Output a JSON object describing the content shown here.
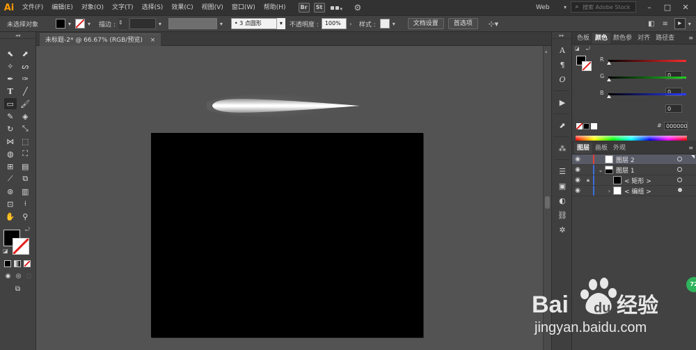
{
  "app": {
    "logo": "Ai",
    "menu": [
      "文件(F)",
      "编辑(E)",
      "对象(O)",
      "文字(T)",
      "选择(S)",
      "效果(C)",
      "视图(V)",
      "窗口(W)",
      "帮助(H)"
    ],
    "bridge_label": "Br",
    "stock_label": "St",
    "workspace": "Web",
    "search_placeholder": "搜索 Adobe Stock"
  },
  "controlbar": {
    "selection_label": "未选择对象",
    "stroke_label": "描边 :",
    "brush_value": "3 点圆形",
    "opacity_label": "不透明度 :",
    "opacity_value": "100%",
    "style_label": "样式 :",
    "doc_setup_button": "文档设置",
    "preferences_button": "首选项"
  },
  "document": {
    "tab_title": "未标题-2* @ 66.67% (RGB/预览)",
    "close": "×"
  },
  "color_panel": {
    "tabs": [
      "色板",
      "颜色",
      "颜色参",
      "对齐",
      "路径查"
    ],
    "active_tab": "颜色",
    "channels": [
      {
        "label": "R",
        "value": "0",
        "color": "#ff2a2a"
      },
      {
        "label": "G",
        "value": "0",
        "color": "#21d021"
      },
      {
        "label": "B",
        "value": "0",
        "color": "#2a3cff"
      }
    ],
    "hex_symbol": "#",
    "hex_value": "000000"
  },
  "layers_panel": {
    "tabs": [
      "图层",
      "画板",
      "外观"
    ],
    "active_tab": "图层",
    "rows": [
      {
        "name": "图层 2",
        "color": "#e0403a",
        "selected": true,
        "thumb": "white",
        "indent": 0,
        "arrow": ""
      },
      {
        "name": "图层 1",
        "color": "#3a6ee0",
        "selected": false,
        "thumb": "split",
        "indent": 0,
        "arrow": "⌄"
      },
      {
        "name": "< 矩形 >",
        "color": "#3a6ee0",
        "selected": false,
        "thumb": "black",
        "indent": 1,
        "arrow": "",
        "locked": true
      },
      {
        "name": "< 编组 >",
        "color": "#3a6ee0",
        "selected": false,
        "thumb": "white",
        "indent": 1,
        "arrow": "›"
      }
    ]
  },
  "watermark": {
    "brand": "Bai",
    "brand2": "du",
    "cn": "经验",
    "url": "jingyan.baidu.com",
    "badge": "72"
  },
  "colors": {
    "menubar": "#323232",
    "panel": "#424242",
    "canvas": "#535353",
    "artboard": "#000000",
    "accent_logo": "#ff9a00"
  }
}
